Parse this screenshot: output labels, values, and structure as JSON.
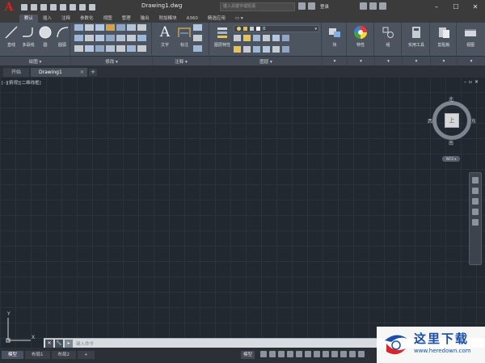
{
  "window": {
    "title": "Drawing1.dwg",
    "search_placeholder": "键入关键字或短语",
    "login_label": "登录",
    "minimize": "–",
    "maximize": "☐",
    "close": "✕"
  },
  "ribbon_tabs": [
    "默认",
    "插入",
    "注释",
    "参数化",
    "视图",
    "管理",
    "输出",
    "附加模块",
    "A360",
    "精选应用",
    "▭ ▾"
  ],
  "ribbon": {
    "draw": {
      "tools": [
        "直线",
        "多段线",
        "圆",
        "圆弧"
      ],
      "footer": "绘图 ▾"
    },
    "modify": {
      "footer": "修改 ▾"
    },
    "annotation": {
      "tools": [
        "文字",
        "标注"
      ],
      "footer": "注释 ▾"
    },
    "layers": {
      "tools": [
        "图层特性"
      ],
      "layer_value": "0",
      "footer": "图层 ▾"
    },
    "block": {
      "label": "块"
    },
    "properties": {
      "label": "特性"
    },
    "groups": {
      "label": "组"
    },
    "utilities": {
      "label": "实用工具"
    },
    "clipboard": {
      "label": "剪贴板"
    },
    "view": {
      "label": "视图"
    }
  },
  "file_tabs": {
    "start": "开始",
    "active": "Drawing1",
    "add": "+"
  },
  "viewport": {
    "label": "[–][俯视][二维线框]",
    "controls": [
      "–",
      "▫",
      "✕"
    ]
  },
  "viewcube": {
    "north": "北",
    "south": "南",
    "east": "东",
    "west": "西",
    "face": "上",
    "wcs": "WCS ▾"
  },
  "ucs": {
    "x": "X",
    "y": "Y"
  },
  "command": {
    "placeholder": "键入命令"
  },
  "layout_tabs": [
    "模型",
    "布局1",
    "布局2"
  ],
  "status": {
    "model": "模型"
  },
  "watermark": {
    "title": "这里下载",
    "url": "www.heredown.com"
  }
}
